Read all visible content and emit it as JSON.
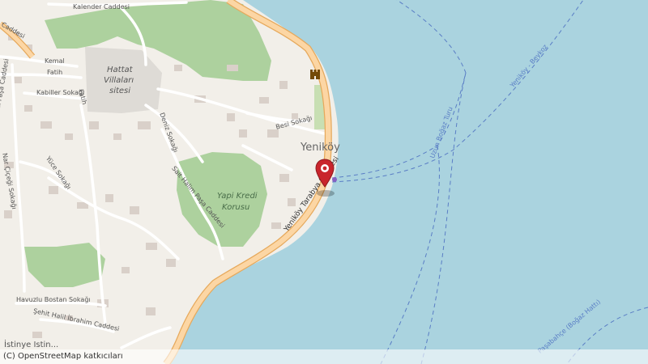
{
  "map": {
    "place_name": "Yeniköy",
    "park_name": "Yapı Kredi Korusu",
    "park_line1": "Yapi Kredi",
    "park_line2": "Korusu",
    "estate_line1": "Hattat",
    "estate_line2": "Villaları",
    "estate_line3": "sitesi",
    "streets": {
      "kalender": "Kalender Caddesi",
      "caddesi_top": "Caddesi",
      "kemal": "Kemal",
      "fatih1": "Fatih",
      "fatih2": "Fatih",
      "kabiller": "Kabiller Sokağı",
      "guzelce": "Güzelce Ali Paşa Caddesi",
      "nar_cicegi": "Nar Çiçeği Sokağı",
      "yuce": "Yüce Sokağı",
      "deniz": "Deniz Sokağı",
      "sait_halim": "Sait Halim Paşa Caddesi",
      "besi": "Besi Sokağı",
      "yenikoy_tarabya": "Yeniköy Tarabya Caddesi",
      "havuzlu_bostan": "Havuzlu Bostan Sokağı",
      "sehit_halil": "Şehit Halil İbrahim Caddesi",
      "istinye": "İstinye Istin..."
    },
    "ferry_routes": {
      "uzun_bogaz": "Uzun Boğaz Turu",
      "yenikoy_beykoz": "Yeniköy - Beykoz",
      "pasabahce": "Paşabahçe (Boğaz Hattı)"
    },
    "marker_icon": "map-pin-icon",
    "castle_icon": "castle-icon"
  },
  "attribution": "(C) OpenStreetMap katkıcıları",
  "colors": {
    "water": "#aad3df",
    "land": "#f2efe9",
    "park": "#add19e",
    "road_major": "#fcd6a4",
    "road_major_casing": "#e6a95c",
    "road_minor": "#ffffff",
    "building": "#d9d0c9",
    "marker": "#c9252c",
    "ferry": "#5a7ec5"
  }
}
